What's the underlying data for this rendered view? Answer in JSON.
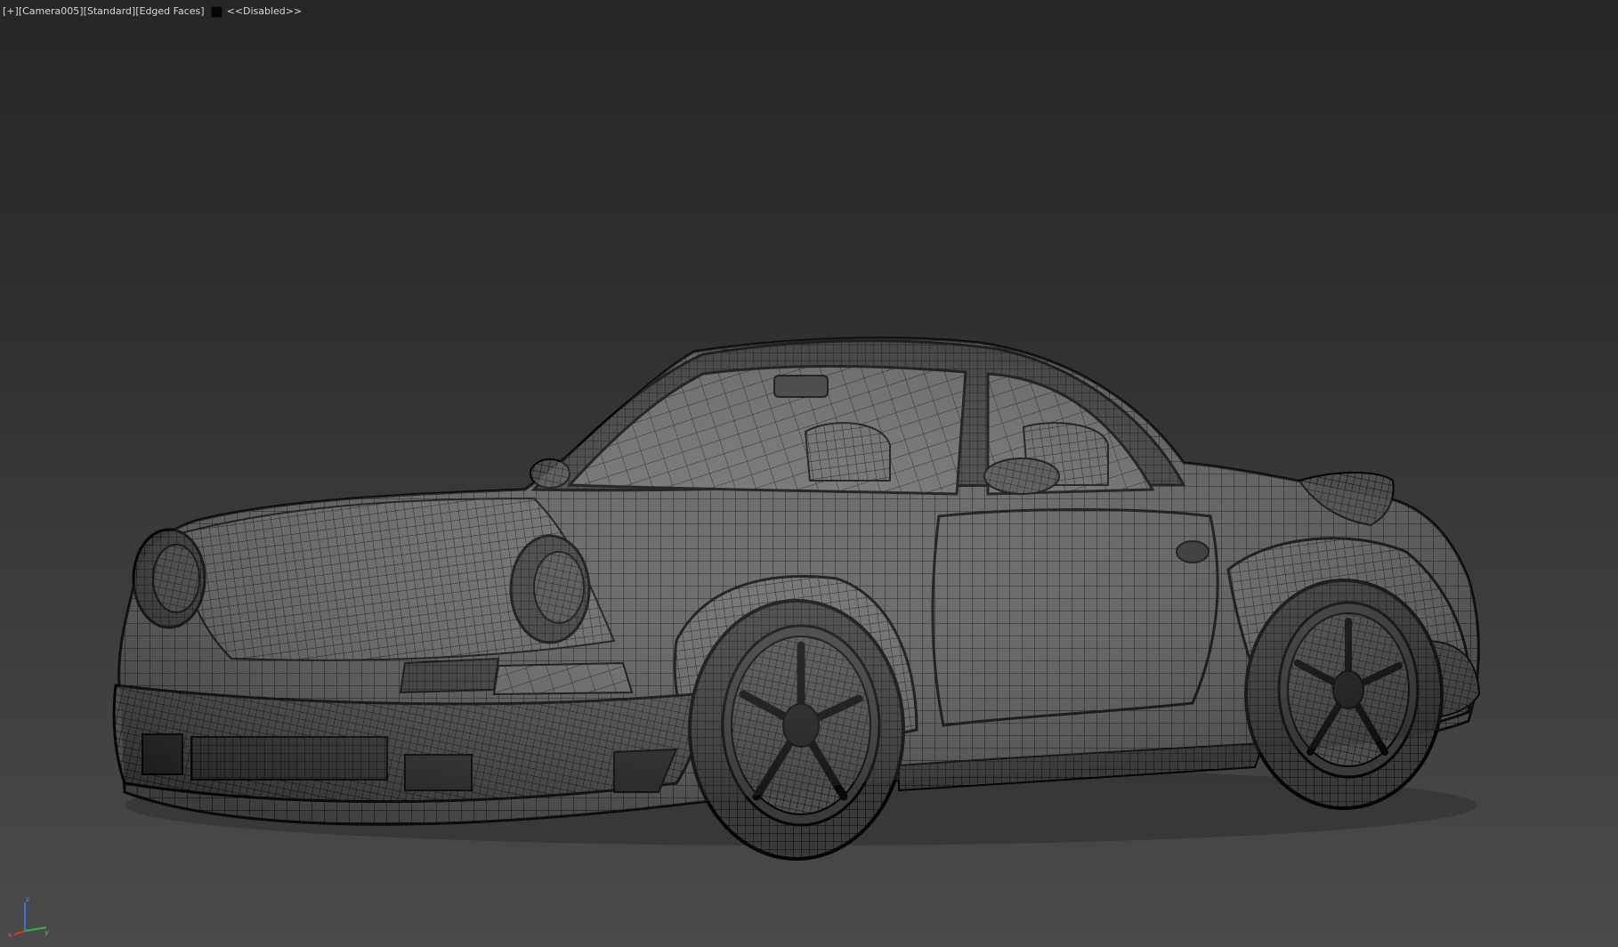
{
  "viewport": {
    "label": {
      "menu": "[+]",
      "camera": "[Camera005]",
      "shading": "[Standard]",
      "style": "[Edged Faces]",
      "status": "<<Disabled>>"
    },
    "colors": {
      "background_top": "#262626",
      "background_bottom": "#4a4a4a",
      "wire": "#0b0b0b",
      "body": "#5a5a5a",
      "axis_x": "#d03a2a",
      "axis_y": "#39b54a",
      "axis_z": "#3a6fe0"
    },
    "gizmo": {
      "x_label": "x",
      "y_label": "y",
      "z_label": "z"
    }
  }
}
